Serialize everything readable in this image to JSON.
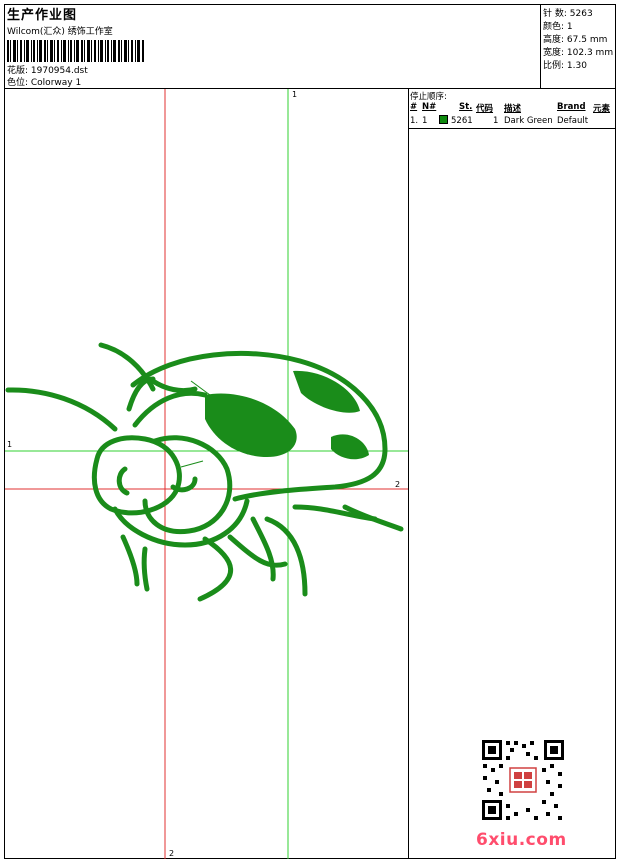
{
  "header": {
    "title": "生产作业图",
    "company": "Wilcom(汇众) 绣饰工作室",
    "design_label": "花版: 1970954.dst",
    "color_label": "色位: Colorway 1"
  },
  "stats": [
    {
      "label": "针 数:",
      "value": "5263"
    },
    {
      "label": "颜色:",
      "value": "1"
    },
    {
      "label": "高度:",
      "value": "67.5 mm"
    },
    {
      "label": "宽度:",
      "value": "102.3 mm"
    },
    {
      "label": "比例:",
      "value": "1.30"
    }
  ],
  "stop_sequence": {
    "heading": "停止顺序:",
    "columns": [
      "#",
      "N#",
      "St.",
      "代码",
      "描述",
      "Brand",
      "元素"
    ],
    "rows": [
      {
        "num": "1.",
        "n": "1",
        "stitches": "5261",
        "code": "1",
        "description": "Dark Green",
        "brand": "Default",
        "swatch": "#0f8a0f"
      }
    ]
  },
  "guides": {
    "green_top": "1",
    "green_left": "1",
    "red_right": "2",
    "red_bottom": "2"
  },
  "watermark": "6xiu.com",
  "colors": {
    "thread": "#1a8c1a",
    "red_guide": "#e03030",
    "green_guide": "#30d030"
  }
}
